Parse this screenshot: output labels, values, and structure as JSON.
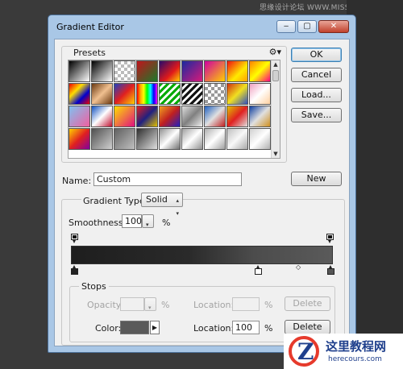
{
  "watermark_top": "思缘设计论坛 WWW.MISSYUAN.COM",
  "window": {
    "title": "Gradient Editor",
    "minimize": "‒",
    "maximize": "▢",
    "close": "✕"
  },
  "presets": {
    "label": "Presets",
    "gear": "⚙▾",
    "swatches": [
      "linear-gradient(135deg,#000,#fff)",
      "linear-gradient(135deg,#000,#666 40%,#fff)",
      "repeating-conic-gradient(#bbb 0 25%,#fff 0 50%) 0 0/8px 8px",
      "linear-gradient(135deg,#c0141c,#1a7a2a)",
      "linear-gradient(135deg,#2a0a6a,#e01a1a 60%,#ffd000)",
      "linear-gradient(135deg,#1a2aa0,#d81a7a)",
      "linear-gradient(135deg,#d000a0,#ffd000)",
      "linear-gradient(135deg,#f01010,#ffea00 60%,#ffa000)",
      "linear-gradient(135deg,#ff8000,#ffff00,#ff0080)",
      "linear-gradient(135deg,#e00,#fd0,#00c,#e00)",
      "linear-gradient(135deg,#6a3810,#f0c090,#6a3810)",
      "linear-gradient(135deg,#2040c0,#e02020,#ffd000)",
      "linear-gradient(90deg,red,orange,yellow,lime,cyan,blue,magenta)",
      "repeating-linear-gradient(135deg,#0a0,#0a0 3px,#fff 3px,#fff 6px)",
      "repeating-linear-gradient(135deg,#111,#111 3px,#fff 3px,#fff 6px)",
      "repeating-conic-gradient(#999 0 25%,#fff 0 50%) 0 0/8px 8px",
      "linear-gradient(135deg,#d03010,#f0e020,#3050c0)",
      "linear-gradient(135deg,#f0a0c0,#ffffff,#ffd0a0)",
      "linear-gradient(135deg,#80c0f0,#f060a0)",
      "linear-gradient(135deg,#1050c0,#ffffff,#c01030)",
      "linear-gradient(135deg,#ffe000,#e01080)",
      "linear-gradient(135deg,#e02020,#202080,#e0c000)",
      "linear-gradient(135deg,#f0a020,#c02020,#2020c0)",
      "linear-gradient(135deg,#e0e0e0,#808080,#f0f0f0)",
      "linear-gradient(135deg,#2060c0,#e0e0e0,#c02020)",
      "linear-gradient(135deg,#e0c000,#e02020,#e0e0e0)",
      "linear-gradient(135deg,#1040a0,#e0e0e0,#d09020)",
      "linear-gradient(135deg,#ffd000,#e02020,#8000a0)",
      "linear-gradient(135deg,#505050,#d0d0d0)",
      "linear-gradient(135deg,#606060,#c0c0c0)",
      "linear-gradient(135deg,#303030,#e0e0e0)",
      "linear-gradient(135deg,#909090,#ffffff,#707070)",
      "linear-gradient(135deg,#a0a0a0,#ffffff,#909090)",
      "linear-gradient(135deg,#b0b0b0,#ffffff,#a0a0a0)",
      "linear-gradient(135deg,#c0c0c0,#f8f8f8,#a8a8a8)",
      "linear-gradient(135deg,#d0d0d0,#ffffff,#b0b0b0)"
    ]
  },
  "buttons": {
    "ok": "OK",
    "cancel": "Cancel",
    "load": "Load...",
    "save": "Save...",
    "new": "New"
  },
  "name": {
    "label": "Name:",
    "value": "Custom"
  },
  "gradient_type": {
    "label": "Gradient Type:",
    "value": "Solid"
  },
  "smoothness": {
    "label": "Smoothness:",
    "value": "100",
    "unit": "%"
  },
  "stops": {
    "label": "Stops",
    "opacity_label": "Opacity:",
    "opacity_unit": "%",
    "opacity_location_label": "Location:",
    "opacity_location_unit": "%",
    "opacity_delete": "Delete",
    "color_label": "Color:",
    "color_value": "#5a5a5a",
    "color_location_label": "Location:",
    "color_location_value": "100",
    "color_location_unit": "%",
    "color_delete": "Delete"
  },
  "logo": {
    "mark": "Z",
    "name": "这里教程网",
    "url": "herecours.com"
  }
}
